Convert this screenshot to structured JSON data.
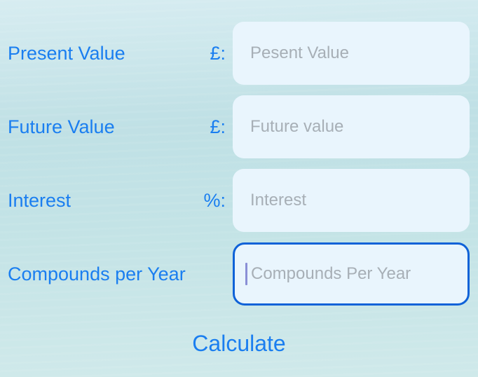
{
  "rows": [
    {
      "label": "Present Value",
      "unit": "£:",
      "placeholder": "Pesent Value"
    },
    {
      "label": "Future Value",
      "unit": "£:",
      "placeholder": "Future value"
    },
    {
      "label": "Interest",
      "unit": "%:",
      "placeholder": "Interest"
    },
    {
      "label": "Compounds per Year",
      "unit": "",
      "placeholder": "Compounds Per Year"
    }
  ],
  "calculate_label": "Calculate",
  "colors": {
    "accent": "#1a7ef0",
    "focus_border": "#0f62d8",
    "field_bg": "#e9f5fd",
    "placeholder": "#a7afb6"
  }
}
